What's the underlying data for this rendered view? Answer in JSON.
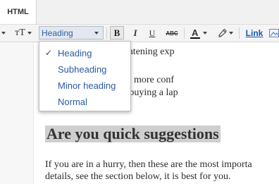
{
  "tabs": {
    "html_label": "HTML"
  },
  "toolbar": {
    "font_size_icon": "ᴛT",
    "format_value": "Heading",
    "bold_label": "B",
    "italic_label": "I",
    "underline_label": "U",
    "strike_label": "ABC",
    "text_color_label": "A",
    "text_color_swatch": "#111111",
    "link_label": "Link"
  },
  "dropdown": {
    "selected_mark": "✓",
    "items": [
      {
        "label": "Heading"
      },
      {
        "label": "Subheading"
      },
      {
        "label": "Minor heading"
      },
      {
        "label": "Normal"
      }
    ]
  },
  "content": {
    "line1": "g and sometimes frightening exp",
    "line2": "written to overcome a more conf",
    "line3": "ns while considering buying a lap",
    "heading": "Are you quick suggestions",
    "para1": "If you are in a hurry, then these are the most importa",
    "para2": "details, see the section below, it is best for you."
  }
}
